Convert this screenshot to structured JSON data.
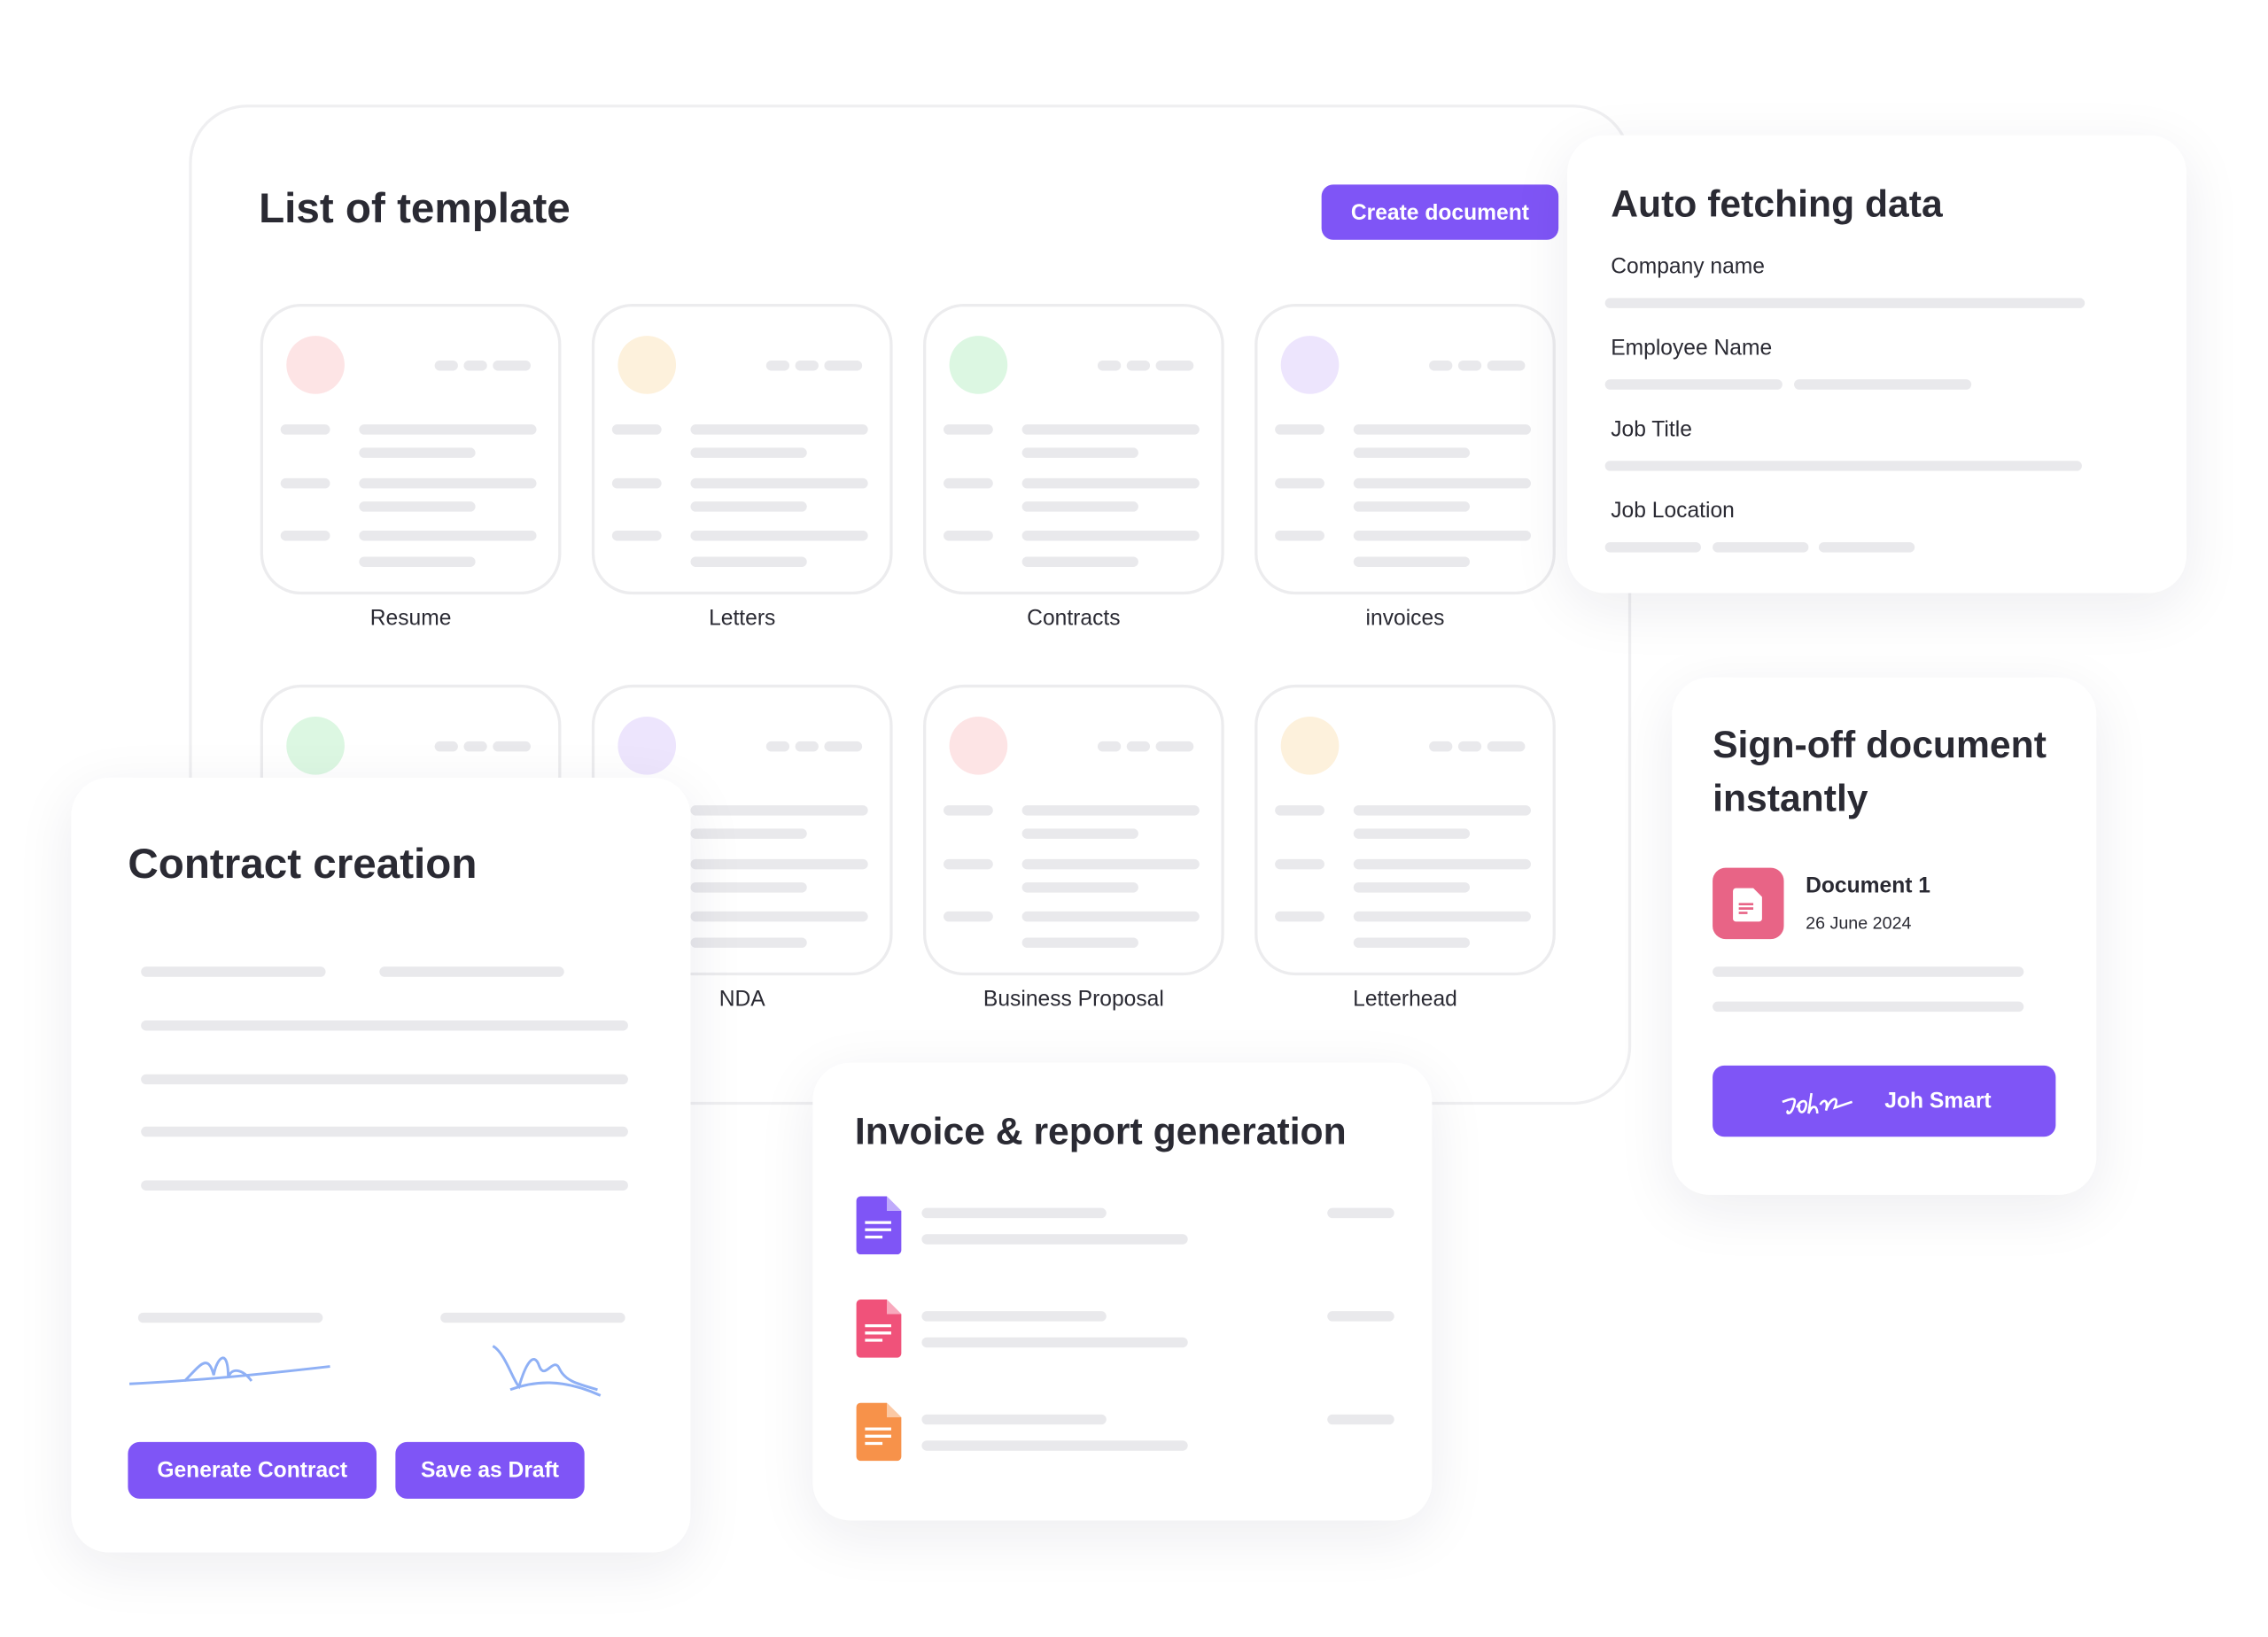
{
  "templates": {
    "title": "List of template",
    "create_button": "Create document",
    "items": [
      {
        "label": "Resume",
        "color": "#fde4e5"
      },
      {
        "label": "Letters",
        "color": "#fdf1dc"
      },
      {
        "label": "Contracts",
        "color": "#dcf7e2"
      },
      {
        "label": "invoices",
        "color": "#ede5fd"
      },
      {
        "label": "",
        "color": "#dcf7e2"
      },
      {
        "label": "NDA",
        "color": "#ede5fd"
      },
      {
        "label": "Business Proposal",
        "color": "#fde4e5"
      },
      {
        "label": "Letterhead",
        "color": "#fdf1dc"
      }
    ]
  },
  "auto_fetch": {
    "title": "Auto fetching data",
    "fields": [
      "Company name",
      "Employee Name",
      "Job Title",
      "Job Location"
    ]
  },
  "signoff": {
    "title": "Sign-off document instantly",
    "doc_name": "Document 1",
    "doc_date": "26 June 2024",
    "sign_button": "Joh Smart",
    "icon_color": "#e86486"
  },
  "contract": {
    "title": "Contract creation",
    "generate_button": "Generate Contract",
    "draft_button": "Save as Draft"
  },
  "invoice": {
    "title": "Invoice & report generation",
    "file_colors": [
      "#7f55f6",
      "#f0527a",
      "#f7924a"
    ]
  },
  "accent": "#7f55f6"
}
